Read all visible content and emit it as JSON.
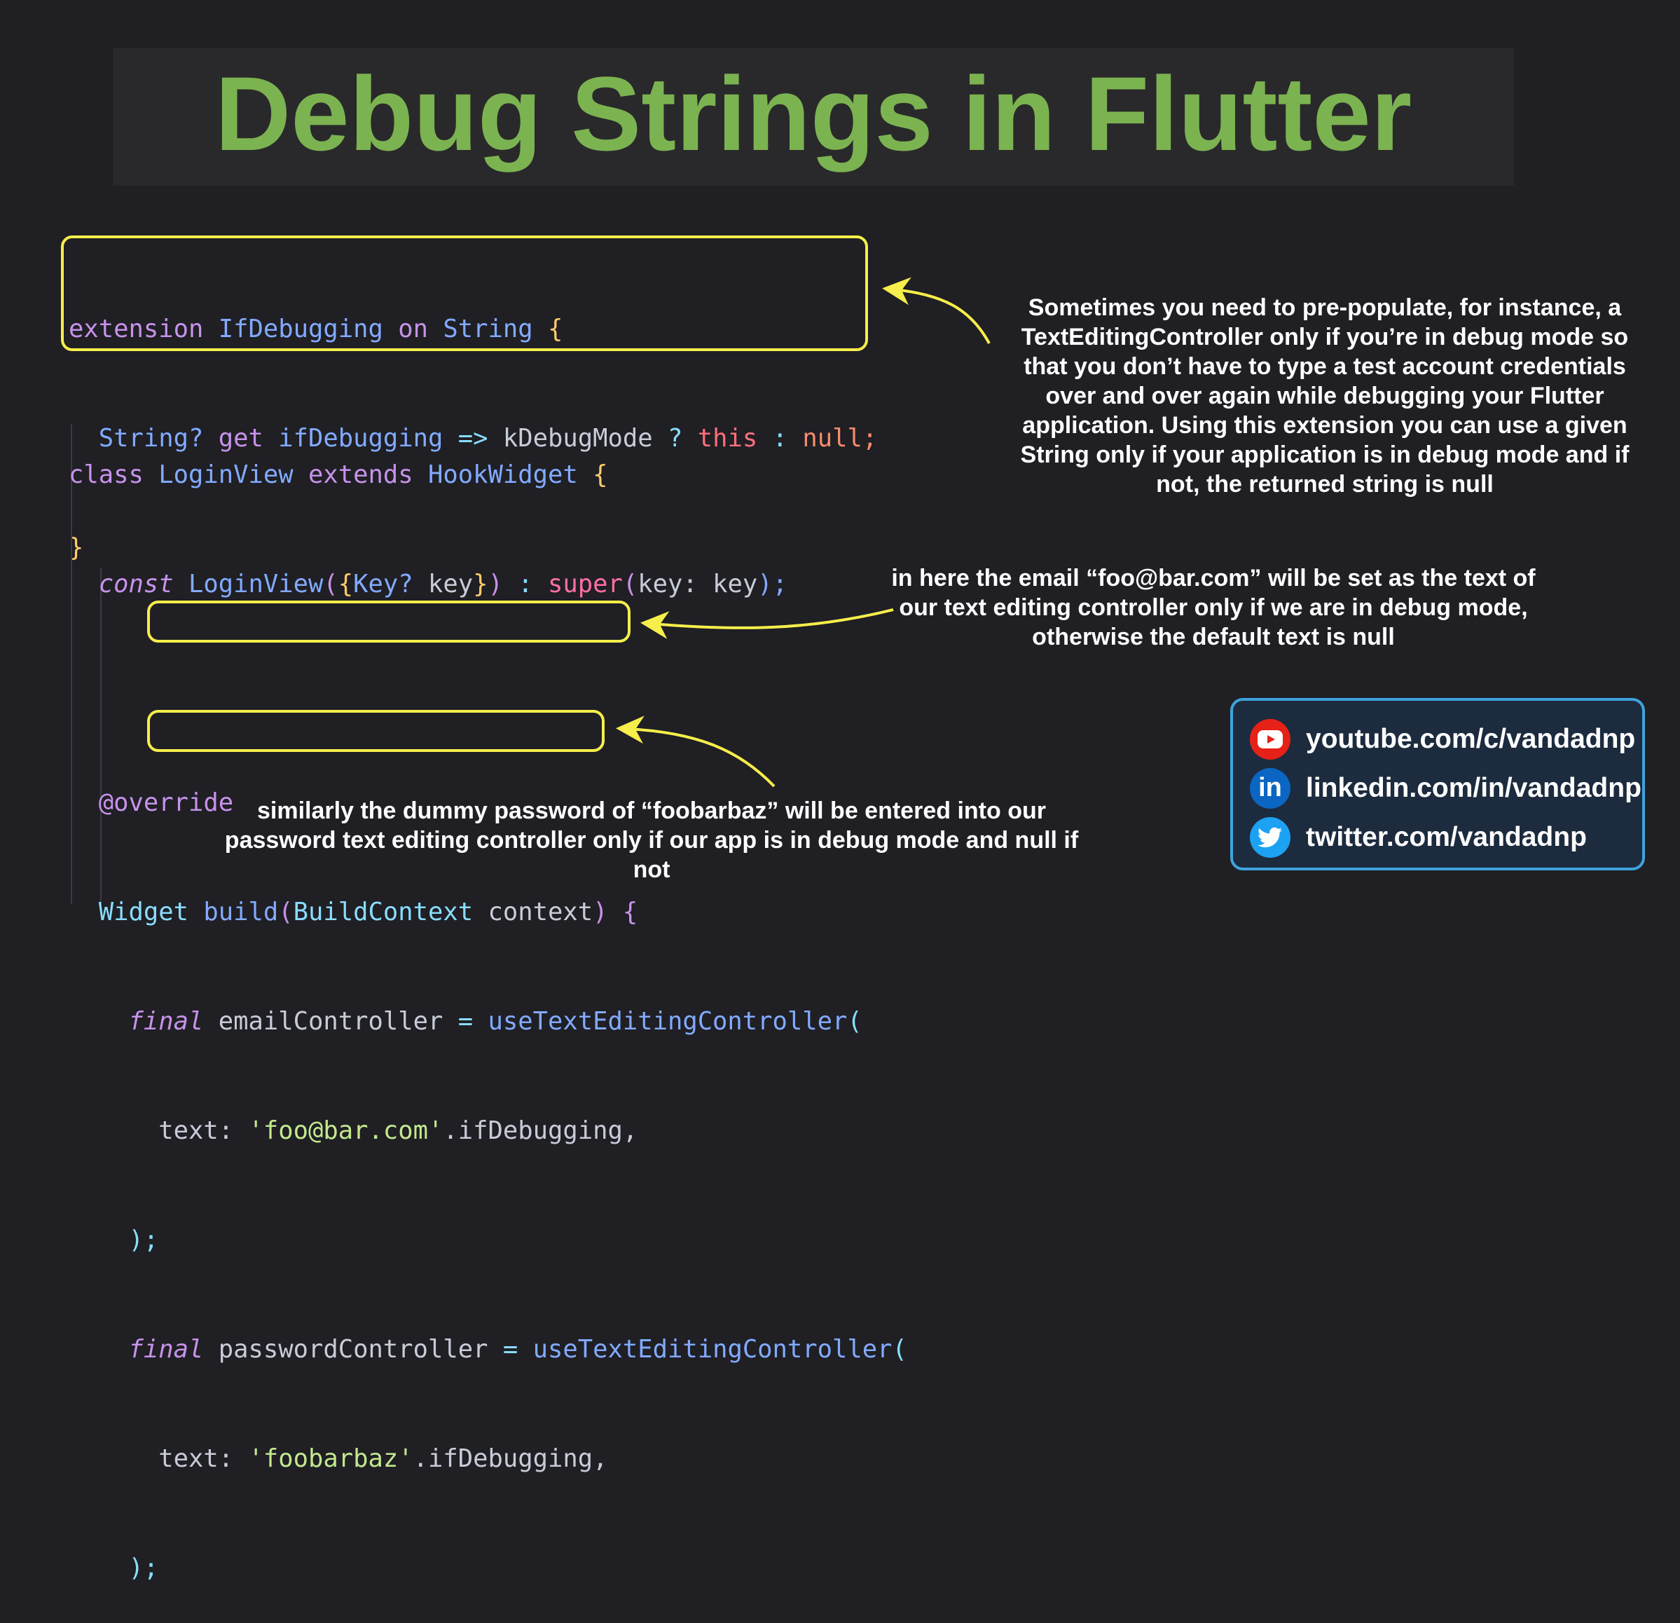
{
  "title": "Debug Strings in Flutter",
  "code": {
    "extension": {
      "line1": [
        "extension",
        " ",
        "IfDebugging",
        " ",
        "on",
        " ",
        "String",
        " ",
        "{"
      ],
      "line2": [
        "  ",
        "String?",
        " ",
        "get",
        " ",
        "ifDebugging",
        " ",
        "=>",
        " ",
        "kDebugMode",
        " ",
        "?",
        " ",
        "this",
        " ",
        ":",
        " ",
        "null;"
      ],
      "line3": [
        "}"
      ]
    },
    "class_line": [
      "class",
      " ",
      "LoginView",
      " ",
      "extends",
      " ",
      "HookWidget",
      " ",
      "{"
    ],
    "ctor_line": [
      "  ",
      "const",
      " ",
      "LoginView",
      "(",
      "{",
      "Key?",
      " ",
      "key",
      "}",
      ")",
      " ",
      ":",
      " ",
      "super",
      "(",
      "key:",
      " ",
      "key",
      ");"
    ],
    "override_line": [
      "  ",
      "@override"
    ],
    "build_line": [
      "  ",
      "Widget",
      " ",
      "build",
      "(",
      "BuildContext",
      " ",
      "context",
      ")",
      " ",
      "{"
    ],
    "email_line": [
      "    ",
      "final",
      " ",
      "emailController",
      " ",
      "=",
      " ",
      "useTextEditingController",
      "("
    ],
    "email_text_line": [
      "      ",
      "text:",
      " ",
      "'foo@bar.com'",
      ".ifDebugging,"
    ],
    "close1": [
      "    ",
      ");"
    ],
    "password_line": [
      "    ",
      "final",
      " ",
      "passwordController",
      " ",
      "=",
      " ",
      "useTextEditingController",
      "("
    ],
    "password_text_line": [
      "      ",
      "text:",
      " ",
      "'foobarbaz'",
      ".ifDebugging,"
    ],
    "close2": [
      "    ",
      ");"
    ]
  },
  "notes": {
    "extension_note": "Sometimes you need to pre-populate, for instance, a TextEditingController only if you’re in debug mode so that you don’t have to type a test account credentials over and over again while debugging your Flutter application. Using this extension you can use a given String only if your application is in debug mode and if not, the returned string is null",
    "email_note": "in here the email “foo@bar.com” will be set as the text of our text editing controller only if we are in debug mode, otherwise the default text is null",
    "password_note": "similarly the dummy password of “foobarbaz” will be entered into our password text editing controller only if our app is in debug mode and null if not"
  },
  "social": {
    "youtube": "youtube.com/c/vandadnp",
    "linkedin": "linkedin.com/in/vandadnp",
    "twitter": "twitter.com/vandadnp"
  },
  "colors": {
    "title": "#7cb351",
    "highlight_box": "#f6ee4a",
    "social_border": "#3ea3dd",
    "youtube": "#e62117",
    "linkedin": "#0a66c2",
    "twitter": "#1da1f2"
  }
}
